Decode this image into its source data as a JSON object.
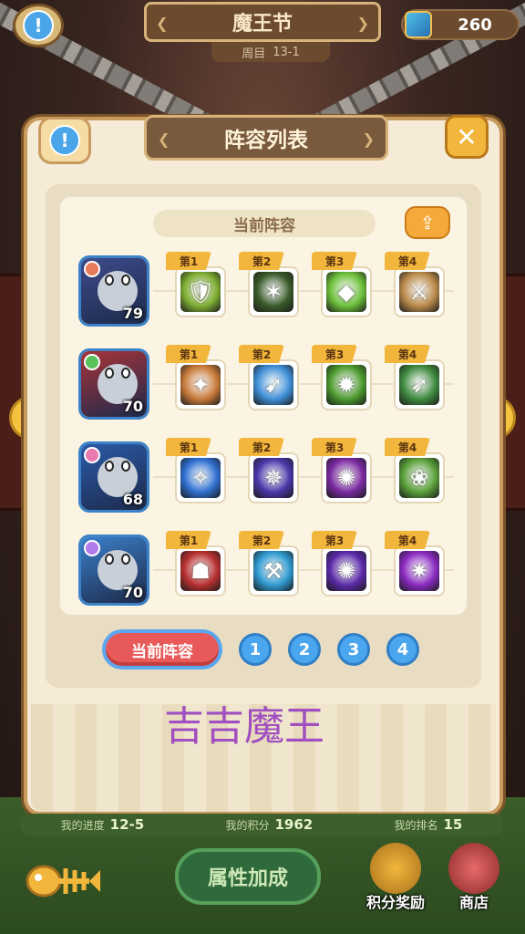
{
  "header": {
    "title": "魔王节",
    "subtitle_label": "周目",
    "subtitle_value": "13-1",
    "currency_value": "260"
  },
  "dialog": {
    "title": "阵容列表",
    "current_lineup_label": "当前阵容",
    "rows": [
      {
        "level": "79",
        "hero_color": "#3e4a8a",
        "skills": [
          {
            "tag": "第1",
            "color": "#7fae33",
            "glyph": "🛡"
          },
          {
            "tag": "第2",
            "color": "#3a5a2a",
            "glyph": "✶"
          },
          {
            "tag": "第3",
            "color": "#6cbf3a",
            "glyph": "◆"
          },
          {
            "tag": "第4",
            "color": "#b98a4a",
            "glyph": "⚔"
          }
        ]
      },
      {
        "level": "70",
        "hero_color": "#a7343a",
        "skills": [
          {
            "tag": "第1",
            "color": "#c87a3a",
            "glyph": "✦"
          },
          {
            "tag": "第2",
            "color": "#3f8fd6",
            "glyph": "➹"
          },
          {
            "tag": "第3",
            "color": "#4c9a2e",
            "glyph": "✹"
          },
          {
            "tag": "第4",
            "color": "#3f8a3f",
            "glyph": "➶"
          }
        ]
      },
      {
        "level": "68",
        "hero_color": "#2a5aa8",
        "skills": [
          {
            "tag": "第1",
            "color": "#2f6fd0",
            "glyph": "✧"
          },
          {
            "tag": "第2",
            "color": "#4a36a8",
            "glyph": "✵"
          },
          {
            "tag": "第3",
            "color": "#7a2aa0",
            "glyph": "✺"
          },
          {
            "tag": "第4",
            "color": "#5aa03a",
            "glyph": "❀"
          }
        ]
      },
      {
        "level": "70",
        "hero_color": "#3a7fc8",
        "skills": [
          {
            "tag": "第1",
            "color": "#b83030",
            "glyph": "☗"
          },
          {
            "tag": "第2",
            "color": "#2f9ad0",
            "glyph": "⚒"
          },
          {
            "tag": "第3",
            "color": "#5a2aa8",
            "glyph": "✺"
          },
          {
            "tag": "第4",
            "color": "#8a2ac0",
            "glyph": "✷"
          }
        ]
      }
    ],
    "tabs": {
      "current": "当前阵容",
      "numbers": [
        "1",
        "2",
        "3",
        "4"
      ]
    },
    "overlay_text": "吉吉魔王"
  },
  "stats": {
    "progress_label": "我的进度",
    "progress_value": "12-5",
    "score_label": "我的积分",
    "score_value": "1962",
    "rank_label": "我的排名",
    "rank_value": "15"
  },
  "bottom": {
    "attr_button": "属性加成",
    "reward_button": "积分奖励",
    "shop_button": "商店"
  }
}
